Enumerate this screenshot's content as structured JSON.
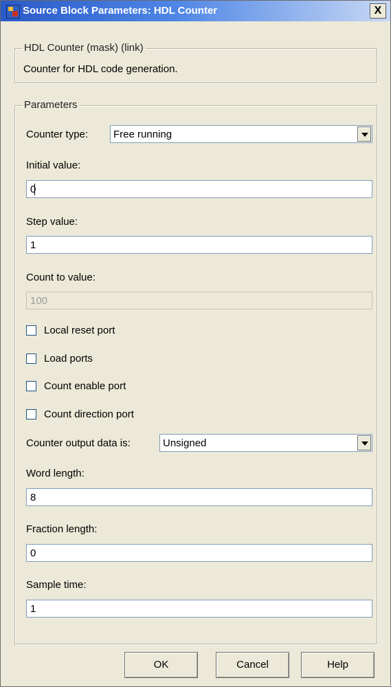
{
  "window": {
    "title": "Source Block Parameters: HDL Counter",
    "close_label": "X"
  },
  "mask_group": {
    "legend": "HDL Counter (mask) (link)",
    "description": "Counter for HDL code generation."
  },
  "params": {
    "legend": "Parameters",
    "counter_type": {
      "label": "Counter type:",
      "value": "Free running"
    },
    "initial_value": {
      "label": "Initial value:",
      "value": "0"
    },
    "step_value": {
      "label": "Step value:",
      "value": "1"
    },
    "count_to_value": {
      "label": "Count to value:",
      "value": "100"
    },
    "checkboxes": [
      {
        "label": "Local reset port",
        "checked": false
      },
      {
        "label": "Load ports",
        "checked": false
      },
      {
        "label": "Count enable port",
        "checked": false
      },
      {
        "label": "Count direction port",
        "checked": false
      }
    ],
    "output_data": {
      "label": "Counter output data is:",
      "value": "Unsigned"
    },
    "word_length": {
      "label": "Word length:",
      "value": "8"
    },
    "fraction_length": {
      "label": "Fraction length:",
      "value": "0"
    },
    "sample_time": {
      "label": "Sample time:",
      "value": "1"
    }
  },
  "buttons": {
    "ok": "OK",
    "cancel": "Cancel",
    "help": "Help"
  },
  "colors": {
    "title_bar": "#2a5ac8",
    "dialog_face": "#ece9d8",
    "field_border": "#7f9db9"
  },
  "icons": [
    "simulink-block-icon",
    "close-icon",
    "chevron-down-icon"
  ]
}
